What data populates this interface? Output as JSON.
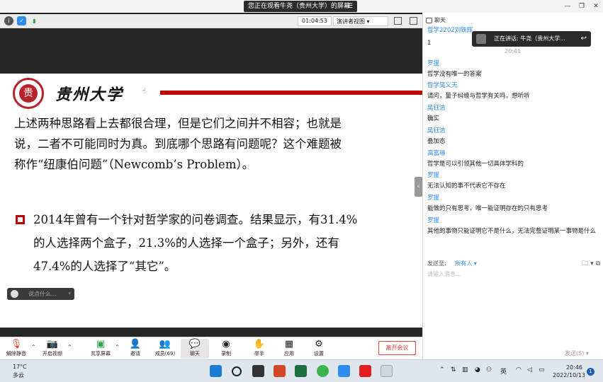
{
  "share_notice": {
    "text": "您正在观看牛尧（贵州大学）的屏幕",
    "menu_glyph": "☰"
  },
  "meeting_top": {
    "timer": "01:04:53",
    "view_mode": "演讲者视图 ▾"
  },
  "slide": {
    "university": "贵州大学",
    "logo_char": "贵",
    "para1": [
      "上述两种思路看上去都很合理，但是它们之间并不相容；也就是",
      "说，二者不可能同时为真。到底哪个思路有问题呢？这个难题被",
      "称作“纽康伯问题”（Newcomb’s Problem）。"
    ],
    "para2": [
      "2014年曾有一个针对哲学家的问卷调查。结果显示，有31.4%",
      "的人选择两个盒子，21.3%的人选择一个盒子；另外，还有",
      "47.4%的人选择了“其它”。"
    ]
  },
  "say_bubble": {
    "placeholder": "说点什么..."
  },
  "toolbar": {
    "mute": "解除静音",
    "video": "开启视频",
    "share": "共享屏幕",
    "invite": "邀请",
    "members": "成员(69)",
    "chat": "聊天",
    "record": "录制",
    "raise_hand": "举手",
    "apps": "应用",
    "settings": "设置",
    "leave": "离开会议"
  },
  "chat": {
    "title": "聊天",
    "time_label": "20:41",
    "speaker": "正在讲话: 牛尧（贵州大学...",
    "messages": [
      {
        "sender": "哲学2202刘铁辉",
        "text": "1"
      },
      {
        "sender": "罗援",
        "text": "哲学没有唯一的答案"
      },
      {
        "sender": "哲学吴义天",
        "text": "请问，量子纠缠与哲学有关吗，想听听"
      },
      {
        "sender": "吴钰洁",
        "text": "确实"
      },
      {
        "sender": "吴钰洁",
        "text": "叠加态"
      },
      {
        "sender": "高富琳",
        "text": "哲学是可以引领其他一切具体学科的"
      },
      {
        "sender": "罗援",
        "text": "无法认知的事不代表它不存在"
      },
      {
        "sender": "罗援",
        "text": "能做的只有思考，唯一能证明存在的只有思考"
      },
      {
        "sender": "罗援",
        "text": "其他的事物只能证明它不是什么，无法完整证明某一事物是什么"
      }
    ],
    "send_to_label": "发送至:",
    "send_to_target": "所有人 ▾",
    "input_placeholder": "请输入消息...",
    "send_button": "发送(S)"
  },
  "taskbar": {
    "temperature": "17°C",
    "weather": "多云",
    "ime": "英",
    "time": "20:46",
    "date": "2022/10/13",
    "notifications": "1"
  }
}
